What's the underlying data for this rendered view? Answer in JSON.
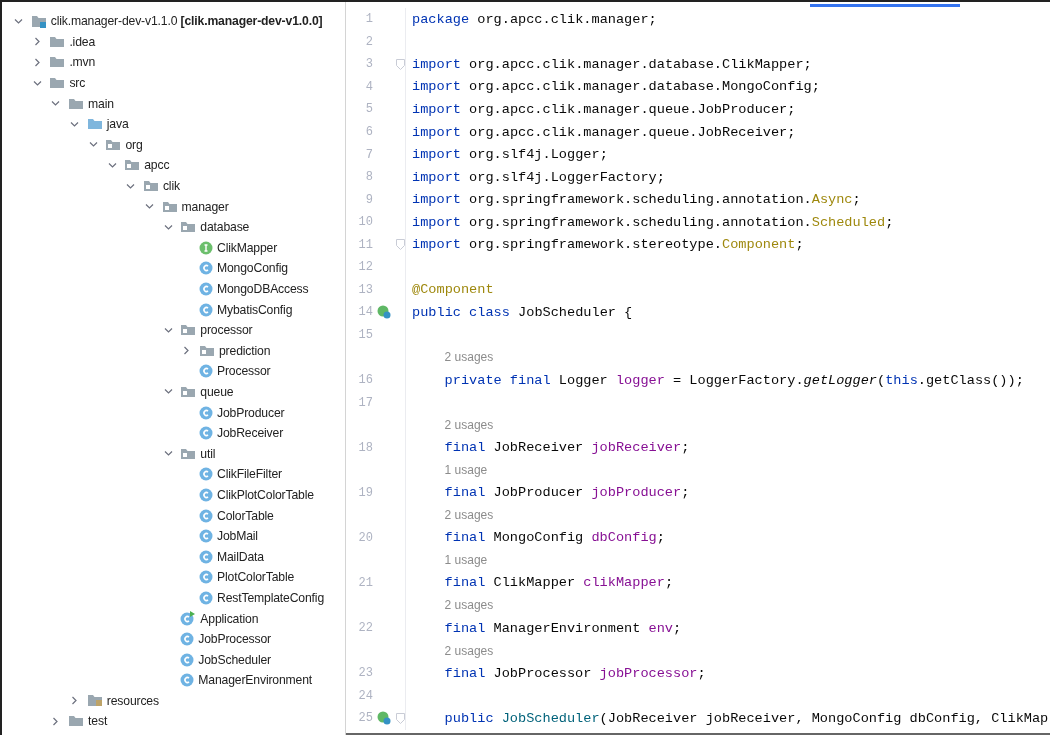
{
  "project_tree": {
    "items": [
      {
        "label": "clik.manager-dev-v1.1.0 **[clik.manager-dev-v1.0.0]**",
        "kind": "project",
        "expanded": true,
        "children": [
          {
            "label": ".idea",
            "kind": "folder",
            "expanded": false
          },
          {
            "label": ".mvn",
            "kind": "folder",
            "expanded": false
          },
          {
            "label": "src",
            "kind": "folder",
            "expanded": true,
            "children": [
              {
                "label": "main",
                "kind": "folder",
                "expanded": true,
                "children": [
                  {
                    "label": "java",
                    "kind": "source",
                    "expanded": true,
                    "children": [
                      {
                        "label": "org",
                        "kind": "package",
                        "expanded": true,
                        "children": [
                          {
                            "label": "apcc",
                            "kind": "package",
                            "expanded": true,
                            "children": [
                              {
                                "label": "clik",
                                "kind": "package",
                                "expanded": true,
                                "children": [
                                  {
                                    "label": "manager",
                                    "kind": "package",
                                    "expanded": true,
                                    "children": [
                                      {
                                        "label": "database",
                                        "kind": "package",
                                        "expanded": true,
                                        "children": [
                                          {
                                            "label": "ClikMapper",
                                            "kind": "interface"
                                          },
                                          {
                                            "label": "MongoConfig",
                                            "kind": "class"
                                          },
                                          {
                                            "label": "MongoDBAccess",
                                            "kind": "class"
                                          },
                                          {
                                            "label": "MybatisConfig",
                                            "kind": "class"
                                          }
                                        ]
                                      },
                                      {
                                        "label": "processor",
                                        "kind": "package",
                                        "expanded": true,
                                        "children": [
                                          {
                                            "label": "prediction",
                                            "kind": "package",
                                            "expanded": false
                                          },
                                          {
                                            "label": "Processor",
                                            "kind": "class"
                                          }
                                        ]
                                      },
                                      {
                                        "label": "queue",
                                        "kind": "package",
                                        "expanded": true,
                                        "children": [
                                          {
                                            "label": "JobProducer",
                                            "kind": "class"
                                          },
                                          {
                                            "label": "JobReceiver",
                                            "kind": "class"
                                          }
                                        ]
                                      },
                                      {
                                        "label": "util",
                                        "kind": "package",
                                        "expanded": true,
                                        "children": [
                                          {
                                            "label": "ClikFileFilter",
                                            "kind": "class"
                                          },
                                          {
                                            "label": "ClikPlotColorTable",
                                            "kind": "class"
                                          },
                                          {
                                            "label": "ColorTable",
                                            "kind": "class"
                                          },
                                          {
                                            "label": "JobMail",
                                            "kind": "class"
                                          },
                                          {
                                            "label": "MailData",
                                            "kind": "class"
                                          },
                                          {
                                            "label": "PlotColorTable",
                                            "kind": "class"
                                          },
                                          {
                                            "label": "RestTemplateConfig",
                                            "kind": "class"
                                          }
                                        ]
                                      },
                                      {
                                        "label": "Application",
                                        "kind": "application"
                                      },
                                      {
                                        "label": "JobProcessor",
                                        "kind": "class"
                                      },
                                      {
                                        "label": "JobScheduler",
                                        "kind": "class"
                                      },
                                      {
                                        "label": "ManagerEnvironment",
                                        "kind": "class"
                                      }
                                    ]
                                  }
                                ]
                              }
                            ]
                          }
                        ]
                      }
                    ]
                  },
                  {
                    "label": "resources",
                    "kind": "resources",
                    "expanded": false
                  }
                ]
              },
              {
                "label": "test",
                "kind": "folder",
                "expanded": false
              }
            ]
          }
        ]
      }
    ]
  },
  "editor": {
    "lines": [
      {
        "kind": "code",
        "number": "1",
        "fold": false,
        "run_icon": false,
        "indented": false,
        "tokens": [
          {
            "text": "package",
            "kind": "keyword"
          },
          {
            "text": " org.apcc.clik.manager;",
            "kind": "plain"
          }
        ]
      },
      {
        "kind": "code",
        "number": "2",
        "fold": false,
        "run_icon": false
      },
      {
        "kind": "code",
        "number": "3",
        "fold": true,
        "run_icon": false,
        "indented": false,
        "tokens": [
          {
            "text": "import",
            "kind": "keyword"
          },
          {
            "text": " org.apcc.clik.manager.database.ClikMapper;",
            "kind": "plain"
          }
        ]
      },
      {
        "kind": "code",
        "number": "4",
        "fold": false,
        "run_icon": false,
        "indented": false,
        "tokens": [
          {
            "text": "import",
            "kind": "keyword"
          },
          {
            "text": " org.apcc.clik.manager.database.MongoConfig;",
            "kind": "plain"
          }
        ]
      },
      {
        "kind": "code",
        "number": "5",
        "fold": false,
        "run_icon": false,
        "indented": false,
        "tokens": [
          {
            "text": "import",
            "kind": "keyword"
          },
          {
            "text": " org.apcc.clik.manager.queue.JobProducer;",
            "kind": "plain"
          }
        ]
      },
      {
        "kind": "code",
        "number": "6",
        "fold": false,
        "run_icon": false,
        "indented": false,
        "tokens": [
          {
            "text": "import",
            "kind": "keyword"
          },
          {
            "text": " org.apcc.clik.manager.queue.JobReceiver;",
            "kind": "plain"
          }
        ]
      },
      {
        "kind": "code",
        "number": "7",
        "fold": false,
        "run_icon": false,
        "indented": false,
        "tokens": [
          {
            "text": "import",
            "kind": "keyword"
          },
          {
            "text": " org.slf4j.Logger;",
            "kind": "plain"
          }
        ]
      },
      {
        "kind": "code",
        "number": "8",
        "fold": false,
        "run_icon": false,
        "indented": false,
        "tokens": [
          {
            "text": "import",
            "kind": "keyword"
          },
          {
            "text": " org.slf4j.LoggerFactory;",
            "kind": "plain"
          }
        ]
      },
      {
        "kind": "code",
        "number": "9",
        "fold": false,
        "run_icon": false,
        "indented": false,
        "tokens": [
          {
            "text": "import",
            "kind": "keyword"
          },
          {
            "text": " org.springframework.scheduling.annotation.",
            "kind": "plain"
          },
          {
            "text": "Async",
            "kind": "annotation"
          },
          {
            "text": ";",
            "kind": "plain"
          }
        ]
      },
      {
        "kind": "code",
        "number": "10",
        "fold": false,
        "run_icon": false,
        "indented": false,
        "tokens": [
          {
            "text": "import",
            "kind": "keyword"
          },
          {
            "text": " org.springframework.scheduling.annotation.",
            "kind": "plain"
          },
          {
            "text": "Scheduled",
            "kind": "annotation"
          },
          {
            "text": ";",
            "kind": "plain"
          }
        ]
      },
      {
        "kind": "code",
        "number": "11",
        "fold": true,
        "run_icon": false,
        "indented": false,
        "tokens": [
          {
            "text": "import",
            "kind": "keyword"
          },
          {
            "text": " org.springframework.stereotype.",
            "kind": "plain"
          },
          {
            "text": "Component",
            "kind": "annotation"
          },
          {
            "text": ";",
            "kind": "plain"
          }
        ]
      },
      {
        "kind": "code",
        "number": "12",
        "fold": false,
        "run_icon": false
      },
      {
        "kind": "code",
        "number": "13",
        "fold": false,
        "run_icon": false,
        "indented": false,
        "tokens": [
          {
            "text": "@Component",
            "kind": "annotation"
          }
        ]
      },
      {
        "kind": "code",
        "number": "14",
        "fold": false,
        "run_icon": true,
        "indented": false,
        "tokens": [
          {
            "text": "public ",
            "kind": "keyword"
          },
          {
            "text": "class",
            "kind": "keyword"
          },
          {
            "text": " JobScheduler {",
            "kind": "plain"
          }
        ]
      },
      {
        "kind": "code",
        "number": "15",
        "fold": false,
        "run_icon": false
      },
      {
        "kind": "usage",
        "text": "2 usages"
      },
      {
        "kind": "code",
        "number": "16",
        "fold": false,
        "run_icon": false,
        "indented": true,
        "tokens": [
          {
            "text": "private final",
            "kind": "keyword"
          },
          {
            "text": " Logger ",
            "kind": "plain"
          },
          {
            "text": "logger",
            "kind": "field"
          },
          {
            "text": " = LoggerFactory.",
            "kind": "plain"
          },
          {
            "text": "getLogger",
            "kind": "static"
          },
          {
            "text": "(",
            "kind": "plain"
          },
          {
            "text": "this",
            "kind": "keyword"
          },
          {
            "text": ".getClass());",
            "kind": "plain"
          }
        ]
      },
      {
        "kind": "code",
        "number": "17",
        "fold": false,
        "run_icon": false
      },
      {
        "kind": "usage",
        "text": "2 usages"
      },
      {
        "kind": "code",
        "number": "18",
        "fold": false,
        "run_icon": false,
        "indented": true,
        "tokens": [
          {
            "text": "final",
            "kind": "keyword"
          },
          {
            "text": " JobReceiver ",
            "kind": "plain"
          },
          {
            "text": "jobReceiver",
            "kind": "field"
          },
          {
            "text": ";",
            "kind": "plain"
          }
        ]
      },
      {
        "kind": "usage",
        "text": "1 usage"
      },
      {
        "kind": "code",
        "number": "19",
        "fold": false,
        "run_icon": false,
        "indented": true,
        "tokens": [
          {
            "text": "final",
            "kind": "keyword"
          },
          {
            "text": " JobProducer ",
            "kind": "plain"
          },
          {
            "text": "jobProducer",
            "kind": "field"
          },
          {
            "text": ";",
            "kind": "plain"
          }
        ]
      },
      {
        "kind": "usage",
        "text": "2 usages"
      },
      {
        "kind": "code",
        "number": "20",
        "fold": false,
        "run_icon": false,
        "indented": true,
        "tokens": [
          {
            "text": "final",
            "kind": "keyword"
          },
          {
            "text": " MongoConfig ",
            "kind": "plain"
          },
          {
            "text": "dbConfig",
            "kind": "field"
          },
          {
            "text": ";",
            "kind": "plain"
          }
        ]
      },
      {
        "kind": "usage",
        "text": "1 usage"
      },
      {
        "kind": "code",
        "number": "21",
        "fold": false,
        "run_icon": false,
        "indented": true,
        "tokens": [
          {
            "text": "final",
            "kind": "keyword"
          },
          {
            "text": " ClikMapper ",
            "kind": "plain"
          },
          {
            "text": "clikMapper",
            "kind": "field"
          },
          {
            "text": ";",
            "kind": "plain"
          }
        ]
      },
      {
        "kind": "usage",
        "text": "2 usages"
      },
      {
        "kind": "code",
        "number": "22",
        "fold": false,
        "run_icon": false,
        "indented": true,
        "tokens": [
          {
            "text": "final",
            "kind": "keyword"
          },
          {
            "text": " ManagerEnvironment ",
            "kind": "plain"
          },
          {
            "text": "env",
            "kind": "field"
          },
          {
            "text": ";",
            "kind": "plain"
          }
        ]
      },
      {
        "kind": "usage",
        "text": "2 usages"
      },
      {
        "kind": "code",
        "number": "23",
        "fold": false,
        "run_icon": false,
        "indented": true,
        "tokens": [
          {
            "text": "final",
            "kind": "keyword"
          },
          {
            "text": " JobProcessor ",
            "kind": "plain"
          },
          {
            "text": "jobProcessor",
            "kind": "field"
          },
          {
            "text": ";",
            "kind": "plain"
          }
        ]
      },
      {
        "kind": "code",
        "number": "24",
        "fold": false,
        "run_icon": false
      },
      {
        "kind": "code",
        "number": "25",
        "fold": true,
        "run_icon": true,
        "indented": true,
        "tokens": [
          {
            "text": "public ",
            "kind": "keyword"
          },
          {
            "text": "JobScheduler",
            "kind": "declaration"
          },
          {
            "text": "(JobReceiver jobReceiver, MongoConfig dbConfig, ClikMap",
            "kind": "plain"
          }
        ]
      }
    ]
  }
}
